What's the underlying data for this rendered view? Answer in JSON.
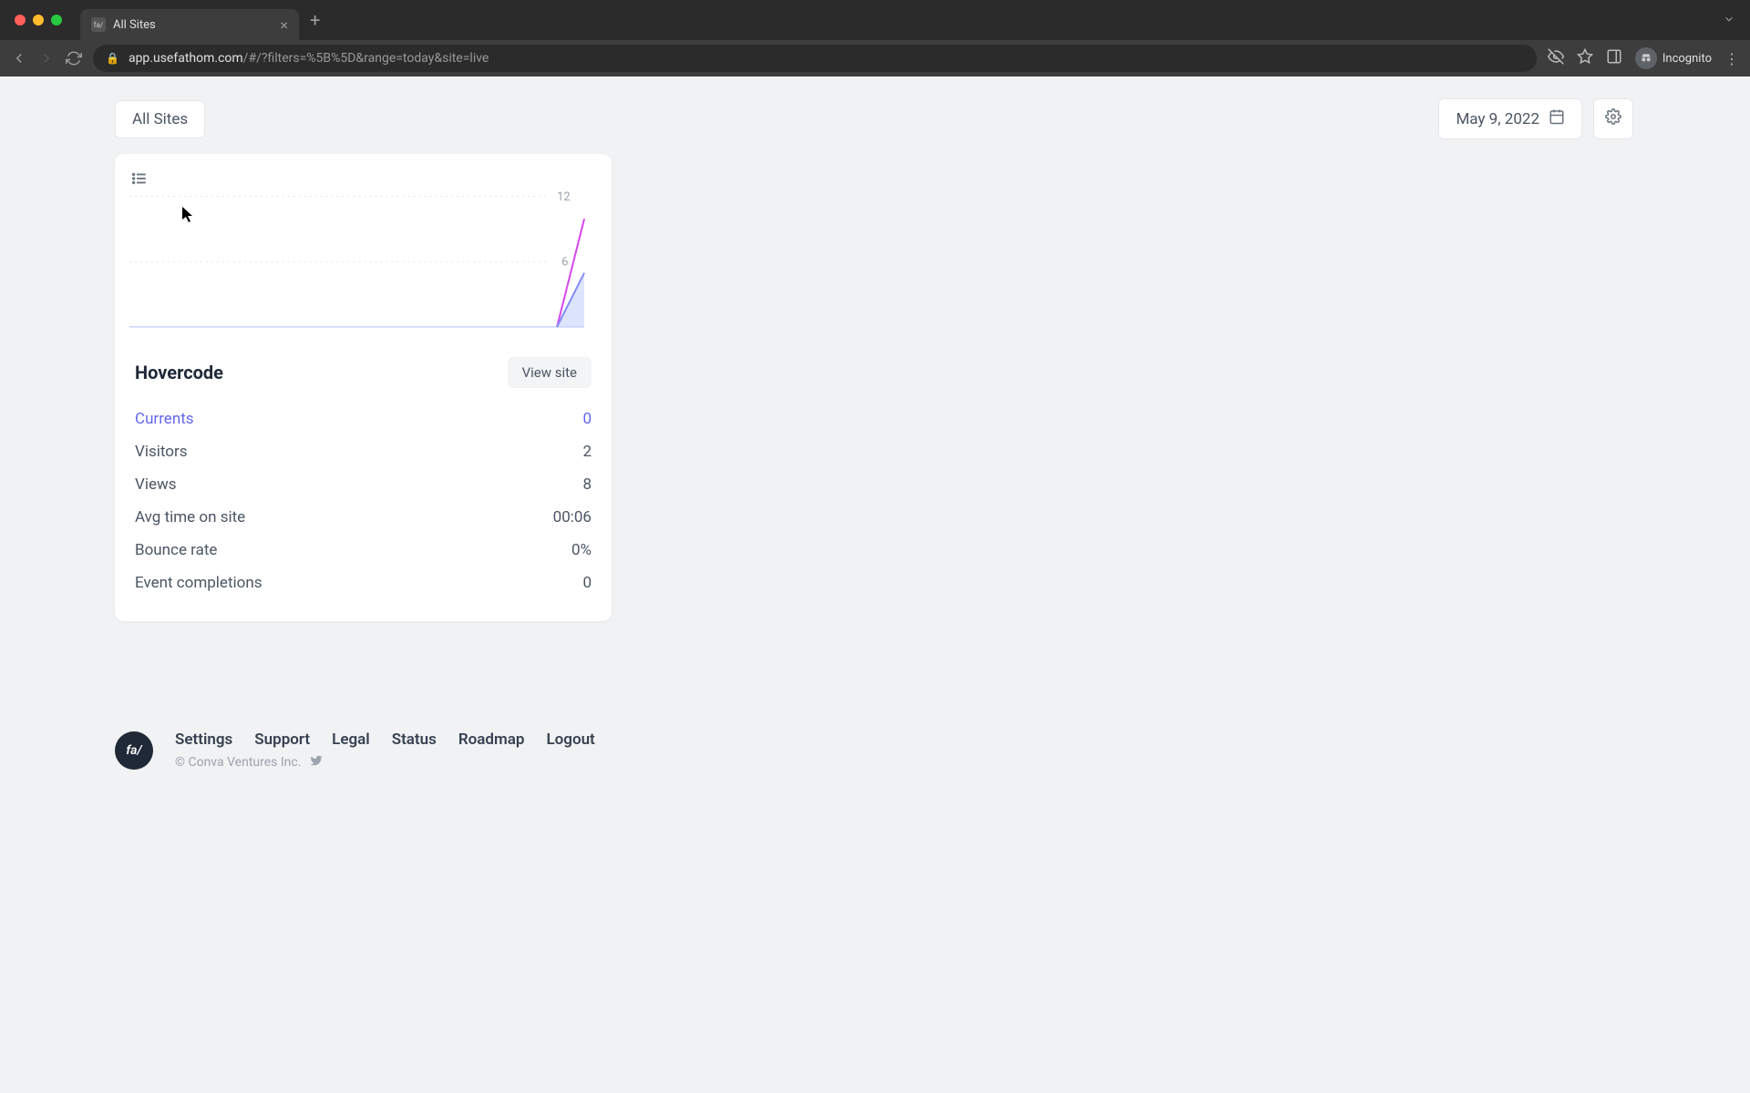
{
  "browser": {
    "tab_title": "All Sites",
    "url_host": "app.usefathom.com",
    "url_path": "/#/?filters=%5B%5D&range=today&site=live",
    "incognito_label": "Incognito"
  },
  "header": {
    "title": "All Sites",
    "date": "May 9, 2022"
  },
  "chart_data": {
    "type": "area",
    "x": [
      0,
      1,
      2,
      3,
      4,
      5,
      6,
      7,
      8,
      9,
      10,
      11
    ],
    "series": [
      {
        "name": "views",
        "values": [
          0,
          0,
          0,
          0,
          0,
          0,
          0,
          0,
          0,
          0,
          0,
          10
        ],
        "color": "#d946ef"
      },
      {
        "name": "visitors",
        "values": [
          0,
          0,
          0,
          0,
          0,
          0,
          0,
          0,
          0,
          0,
          0,
          5
        ],
        "color": "#a5b4fc"
      }
    ],
    "ylim": [
      0,
      12
    ],
    "yticks": [
      6,
      12
    ],
    "title": "",
    "xlabel": "",
    "ylabel": ""
  },
  "site": {
    "name": "Hovercode",
    "view_label": "View site",
    "stats": [
      {
        "label": "Currents",
        "value": "0",
        "highlight": true
      },
      {
        "label": "Visitors",
        "value": "2",
        "highlight": false
      },
      {
        "label": "Views",
        "value": "8",
        "highlight": false
      },
      {
        "label": "Avg time on site",
        "value": "00:06",
        "highlight": false
      },
      {
        "label": "Bounce rate",
        "value": "0%",
        "highlight": false
      },
      {
        "label": "Event completions",
        "value": "0",
        "highlight": false
      }
    ]
  },
  "footer": {
    "logo_text": "fa/",
    "links": [
      "Settings",
      "Support",
      "Legal",
      "Status",
      "Roadmap",
      "Logout"
    ],
    "copyright": "© Conva Ventures Inc."
  }
}
